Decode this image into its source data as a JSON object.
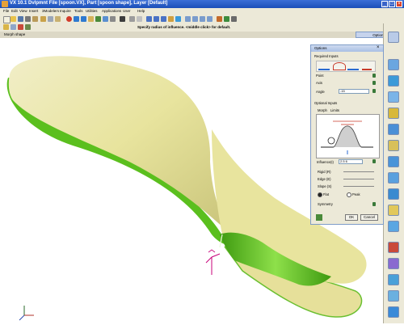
{
  "window": {
    "title_text": "VX 10.1 Dvlpmnt     File [spoon.VX], Part [spoon shape], Layer [Default]",
    "controls": [
      "_",
      "□",
      "×"
    ]
  },
  "menu": [
    "File",
    "Edit",
    "View",
    "Insert",
    "3Modelers",
    "Inquire",
    "Tools",
    "Utilities",
    "Applications",
    "User",
    "Help"
  ],
  "prompt": "Specify radius of influence.  <middle click> for default.",
  "stage_name": "Morph shape",
  "options_tab": "Options",
  "dialog": {
    "title": "Options",
    "required_section": "Required Inputs",
    "point_label": "Point",
    "axis_label": "Axis",
    "angle_label": "Angle",
    "angle_value": "-15",
    "optional_section": "Optional Inputs",
    "tabs": [
      "Morph",
      "Limits"
    ],
    "influence_label": "Influence(I)",
    "influence_value": "2.5  6",
    "rigid_label": "Rigid (R)",
    "edge_label": "Edge (E)",
    "slope_label": "Slope (S)",
    "flat_label": "Flat",
    "peak_label": "Peak",
    "symmetry_label": "Symmetry",
    "ok_label": "OK",
    "cancel_label": "Cancel"
  },
  "colors": {
    "titlebar": "#1b4fb8",
    "chrome": "#ece9d8",
    "spoon_surface": "#e8e49e",
    "spoon_edge": "#5bbf1e",
    "axis_magenta": "#c8007a"
  }
}
